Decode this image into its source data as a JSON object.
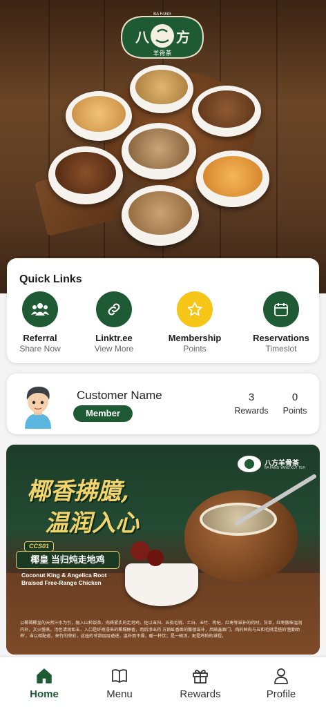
{
  "colors": {
    "primary": "#1e5a34",
    "accent": "#f5c518",
    "text": "#1b1b1b"
  },
  "hero": {
    "logo": {
      "top_text": "BA FANG",
      "brand_left": "八",
      "brand_right": "方",
      "subtitle": "羊骨茶"
    }
  },
  "quick_links": {
    "title": "Quick Links",
    "items": [
      {
        "label": "Referral",
        "sub": "Share Now",
        "icon": "people-icon"
      },
      {
        "label": "Linktr.ee",
        "sub": "View More",
        "icon": "link-icon"
      },
      {
        "label": "Membership",
        "sub": "Points",
        "icon": "star-icon"
      },
      {
        "label": "Reservations",
        "sub": "Timeslot",
        "icon": "calendar-icon"
      }
    ]
  },
  "customer": {
    "name": "Customer Name",
    "tier": "Member",
    "rewards": {
      "value": "3",
      "label": "Rewards"
    },
    "points": {
      "value": "0",
      "label": "Points"
    }
  },
  "promo": {
    "brand": "八方羊骨茶",
    "brand_sub": "BA FANG YANG KUT TEH",
    "headline_1": "椰香拂臆,",
    "headline_2": "温润入心",
    "code": "CCS01",
    "dish_cn": "椰皇 当归炖走地鸡",
    "dish_en_1": "Coconut King & Angelica Root",
    "dish_en_2": "Braised Free-Range Chicken",
    "fine_print": "以椰褐椰皇的天然汁水为引，融入山科饭茶，肉质紧实的走地鸡，佐以当归、五指毛桃、土日、玉竹、枸杞，红枣等滋补的药材，甘草，红枣散味温润内补，文火慢蒸，汤色清润如玉，入口是纤雨浸来的椰糯醇香，而后渗出药 方铸虹香面的馨德滋补，后颇鑫面门，肉的鲜肉与五和毛桃混搭的'营勤助养'，当以相配道，来竹的荣彩，这桂的甘甜层层递进，温补而不燥，暖一杯饮；是一碗汤，更是鸡粕的滋程。"
  },
  "nav": {
    "items": [
      {
        "label": "Home",
        "icon": "home-icon",
        "active": true
      },
      {
        "label": "Menu",
        "icon": "book-icon",
        "active": false
      },
      {
        "label": "Rewards",
        "icon": "gift-icon",
        "active": false
      },
      {
        "label": "Profile",
        "icon": "person-icon",
        "active": false
      }
    ]
  }
}
